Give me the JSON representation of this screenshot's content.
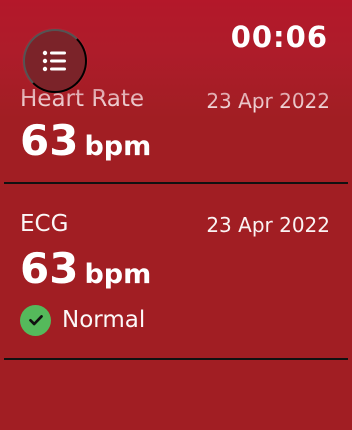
{
  "header": {
    "time": "00:06",
    "menu_icon": "list-icon"
  },
  "entries": [
    {
      "title": "Heart Rate",
      "date": "23 Apr 2022",
      "value": "63",
      "unit": "bpm"
    },
    {
      "title": "ECG",
      "date": "23 Apr 2022",
      "value": "63",
      "unit": "bpm",
      "status": {
        "label": "Normal",
        "icon": "check-circle-icon",
        "color": "#55b95b"
      }
    }
  ],
  "colors": {
    "background": "#a11e23",
    "menu_button": "#7b2329",
    "divider": "#111111"
  }
}
